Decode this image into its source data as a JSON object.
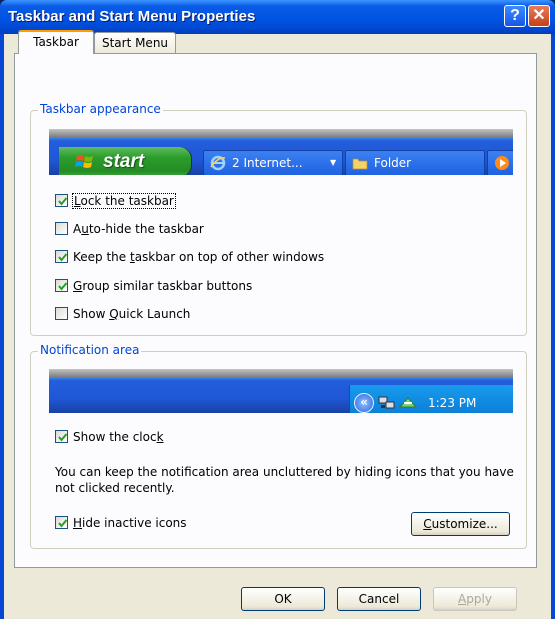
{
  "window": {
    "title": "Taskbar and Start Menu Properties"
  },
  "titlebar": {
    "help_glyph": "?",
    "close_glyph": "✕"
  },
  "tabs": [
    {
      "label": "Taskbar",
      "active": true
    },
    {
      "label": "Start Menu",
      "active": false
    }
  ],
  "appearance": {
    "legend": "Taskbar appearance",
    "preview": {
      "start_label": "start",
      "buttons": [
        {
          "label": "2 Internet...",
          "icon": "ie-icon"
        },
        {
          "label": "Folder",
          "icon": "folder-icon"
        }
      ]
    },
    "checkboxes": [
      {
        "pre": "",
        "acc": "L",
        "post": "ock the taskbar",
        "checked": true
      },
      {
        "pre": "A",
        "acc": "u",
        "post": "to-hide the taskbar",
        "checked": false
      },
      {
        "pre": "Keep the ",
        "acc": "t",
        "post": "askbar on top of other windows",
        "checked": true
      },
      {
        "pre": "",
        "acc": "G",
        "post": "roup similar taskbar buttons",
        "checked": true
      },
      {
        "pre": "Show ",
        "acc": "Q",
        "post": "uick Launch",
        "checked": false
      }
    ]
  },
  "notification": {
    "legend": "Notification area",
    "preview": {
      "clock": "1:23 PM",
      "chevron": "«"
    },
    "show_clock": {
      "pre": "Show the cloc",
      "acc": "k",
      "post": "",
      "checked": true
    },
    "description": "You can keep the notification area uncluttered by hiding icons that you have not clicked recently.",
    "hide_inactive": {
      "pre": "",
      "acc": "H",
      "post": "ide inactive icons",
      "checked": true
    },
    "customize": {
      "acc": "C",
      "post": "ustomize..."
    }
  },
  "footer": {
    "ok": "OK",
    "cancel": "Cancel",
    "apply": {
      "acc": "A",
      "post": "pply",
      "enabled": false
    }
  },
  "colors": {
    "title_bar": "#0054e3",
    "dialog_face": "#ece9d8",
    "group_label": "#0046d5",
    "taskbar_blue": "#245edb",
    "start_green": "#2b9d2b",
    "tray_blue": "#0e8ae0"
  }
}
